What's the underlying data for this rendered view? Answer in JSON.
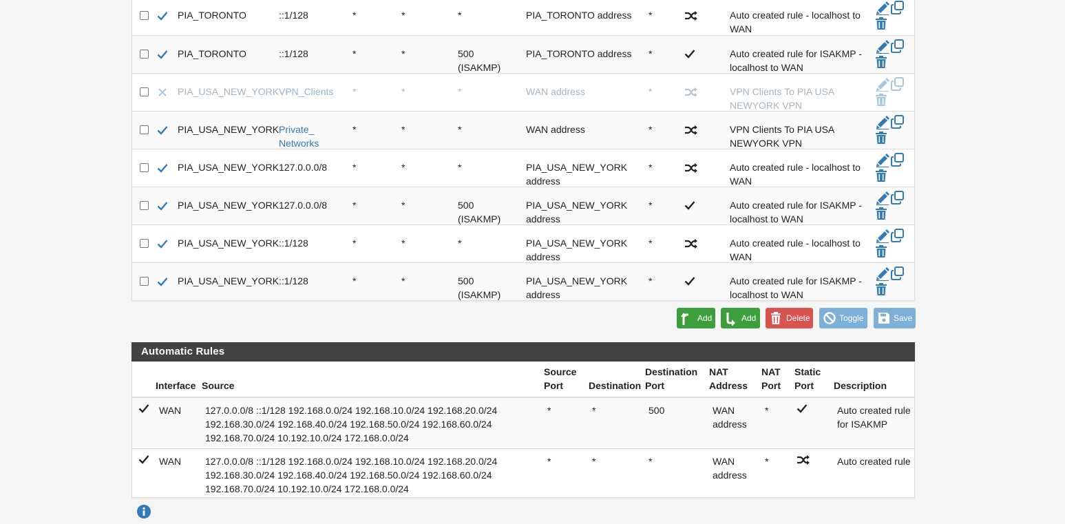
{
  "manual_rules": [
    {
      "enabled": true,
      "interface": "PIA_TORONTO",
      "source": "::1/128",
      "source_link": false,
      "source_port": "*",
      "destination": "*",
      "dest_port": "*",
      "nat_address": "PIA_TORONTO address",
      "nat_port": "*",
      "static_port": "shuffle",
      "description": "Auto created rule - localhost to WAN"
    },
    {
      "enabled": true,
      "interface": "PIA_TORONTO",
      "source": "::1/128",
      "source_link": false,
      "source_port": "*",
      "destination": "*",
      "dest_port": "500 (ISAKMP)",
      "nat_address": "PIA_TORONTO address",
      "nat_port": "*",
      "static_port": "check",
      "description": "Auto created rule for ISAKMP - localhost to WAN"
    },
    {
      "enabled": false,
      "interface": "PIA_USA_NEW_YORK",
      "source": "VPN_Clients",
      "source_link": true,
      "source_port": "*",
      "destination": "*",
      "dest_port": "*",
      "nat_address": "WAN address",
      "nat_port": "*",
      "static_port": "shuffle",
      "description": "VPN Clients To PIA USA NEWYORK VPN"
    },
    {
      "enabled": true,
      "interface": "PIA_USA_NEW_YORK",
      "source": "Private_ Networks",
      "source_link": true,
      "source_port": "*",
      "destination": "*",
      "dest_port": "*",
      "nat_address": "WAN address",
      "nat_port": "*",
      "static_port": "shuffle",
      "description": "VPN Clients To PIA USA NEWYORK VPN"
    },
    {
      "enabled": true,
      "interface": "PIA_USA_NEW_YORK",
      "source": "127.0.0.0/8",
      "source_link": false,
      "source_port": "*",
      "destination": "*",
      "dest_port": "*",
      "nat_address": "PIA_USA_NEW_YORK address",
      "nat_port": "*",
      "static_port": "shuffle",
      "description": "Auto created rule - localhost to WAN"
    },
    {
      "enabled": true,
      "interface": "PIA_USA_NEW_YORK",
      "source": "127.0.0.0/8",
      "source_link": false,
      "source_port": "*",
      "destination": "*",
      "dest_port": "500 (ISAKMP)",
      "nat_address": "PIA_USA_NEW_YORK address",
      "nat_port": "*",
      "static_port": "check",
      "description": "Auto created rule for ISAKMP - localhost to WAN"
    },
    {
      "enabled": true,
      "interface": "PIA_USA_NEW_YORK",
      "source": "::1/128",
      "source_link": false,
      "source_port": "*",
      "destination": "*",
      "dest_port": "*",
      "nat_address": "PIA_USA_NEW_YORK address",
      "nat_port": "*",
      "static_port": "shuffle",
      "description": "Auto created rule - localhost to WAN"
    },
    {
      "enabled": true,
      "interface": "PIA_USA_NEW_YORK",
      "source": "::1/128",
      "source_link": false,
      "source_port": "*",
      "destination": "*",
      "dest_port": "500 (ISAKMP)",
      "nat_address": "PIA_USA_NEW_YORK address",
      "nat_port": "*",
      "static_port": "check",
      "description": "Auto created rule for ISAKMP - localhost to WAN"
    }
  ],
  "buttons": {
    "add_top": "Add",
    "add_bottom": "Add",
    "delete": "Delete",
    "toggle": "Toggle",
    "save": "Save"
  },
  "colors": {
    "success": "#3c9e3c",
    "danger": "#d9534f",
    "info_disabled": "#7db0d9",
    "link": "#337ab7",
    "panel_heading": "#424242"
  },
  "automatic": {
    "title": "Automatic Rules",
    "headers": {
      "interface": "Interface",
      "source": "Source",
      "source_port": "Source Port",
      "destination": "Destination",
      "dest_port": "Destination Port",
      "nat_address": "NAT Address",
      "nat_port": "NAT Port",
      "static_port": "Static Port",
      "description": "Description"
    },
    "rules": [
      {
        "interface": "WAN",
        "source": "127.0.0.0/8 ::1/128 192.168.0.0/24 192.168.10.0/24 192.168.20.0/24 192.168.30.0/24 192.168.40.0/24 192.168.50.0/24 192.168.60.0/24 192.168.70.0/24 10.192.10.0/24 172.168.0.0/24",
        "source_port": "*",
        "destination": "*",
        "dest_port": "500",
        "nat_address": "WAN address",
        "nat_port": "*",
        "static_port": "check",
        "description": "Auto created rule for ISAKMP"
      },
      {
        "interface": "WAN",
        "source": "127.0.0.0/8 ::1/128 192.168.0.0/24 192.168.10.0/24 192.168.20.0/24 192.168.30.0/24 192.168.40.0/24 192.168.50.0/24 192.168.60.0/24 192.168.70.0/24 10.192.10.0/24 172.168.0.0/24",
        "source_port": "*",
        "destination": "*",
        "dest_port": "*",
        "nat_address": "WAN address",
        "nat_port": "*",
        "static_port": "shuffle",
        "description": "Auto created rule"
      }
    ]
  }
}
